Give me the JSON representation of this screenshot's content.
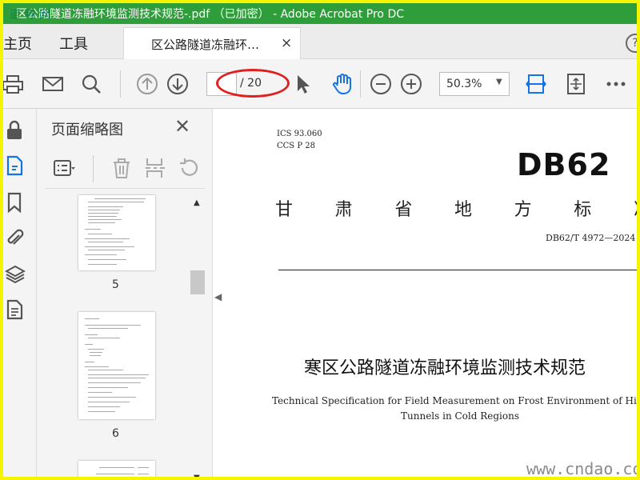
{
  "window": {
    "title": "区公路隧道冻融环境监测技术规范-.pdf （已加密） - Adobe Acrobat Pro DC",
    "watermark": "道 称 网"
  },
  "tabs": {
    "home": "主页",
    "tools": "工具",
    "document": "区公路隧道冻融环…",
    "close_glyph": "×",
    "help_glyph": "?"
  },
  "toolbar": {
    "page_current": "",
    "page_total": "/ 20",
    "zoom": "50.3%",
    "icons": [
      "print-icon",
      "mail-icon",
      "search-icon",
      "prev-page-icon",
      "next-page-icon",
      "select-cursor-icon",
      "hand-icon",
      "zoom-out-icon",
      "zoom-in-icon",
      "fit-page-icon",
      "scroll-mode-icon",
      "more-icon"
    ]
  },
  "rail": {
    "icons": [
      "lock-icon",
      "attach-page-icon",
      "bookmark-icon",
      "paperclip-icon",
      "layers-icon",
      "content-icon"
    ]
  },
  "thumbnails_panel": {
    "title": "页面缩略图",
    "close_glyph": "✕",
    "pages": [
      {
        "number": "5"
      },
      {
        "number": "6"
      }
    ]
  },
  "document": {
    "ics": "ICS  93.060",
    "ccs": "CCS  P 28",
    "code": "DB62",
    "province_chars": [
      "甘",
      "肃",
      "省",
      "地",
      "方",
      "标",
      "准"
    ],
    "standard_number": "DB62/T 4972—2024",
    "title_cn": "寒区公路隧道冻融环境监测技术规范",
    "title_en_line1": "Technical Specification for Field Measurement on Frost Environment of Highway",
    "title_en_line2": "Tunnels in Cold Regions"
  },
  "site_watermark": "www.cndao.com",
  "colors": {
    "titlebar": "#2e9e3a",
    "frame": "#f5f500",
    "accent": "#1473e6",
    "annotation": "#e02020"
  }
}
